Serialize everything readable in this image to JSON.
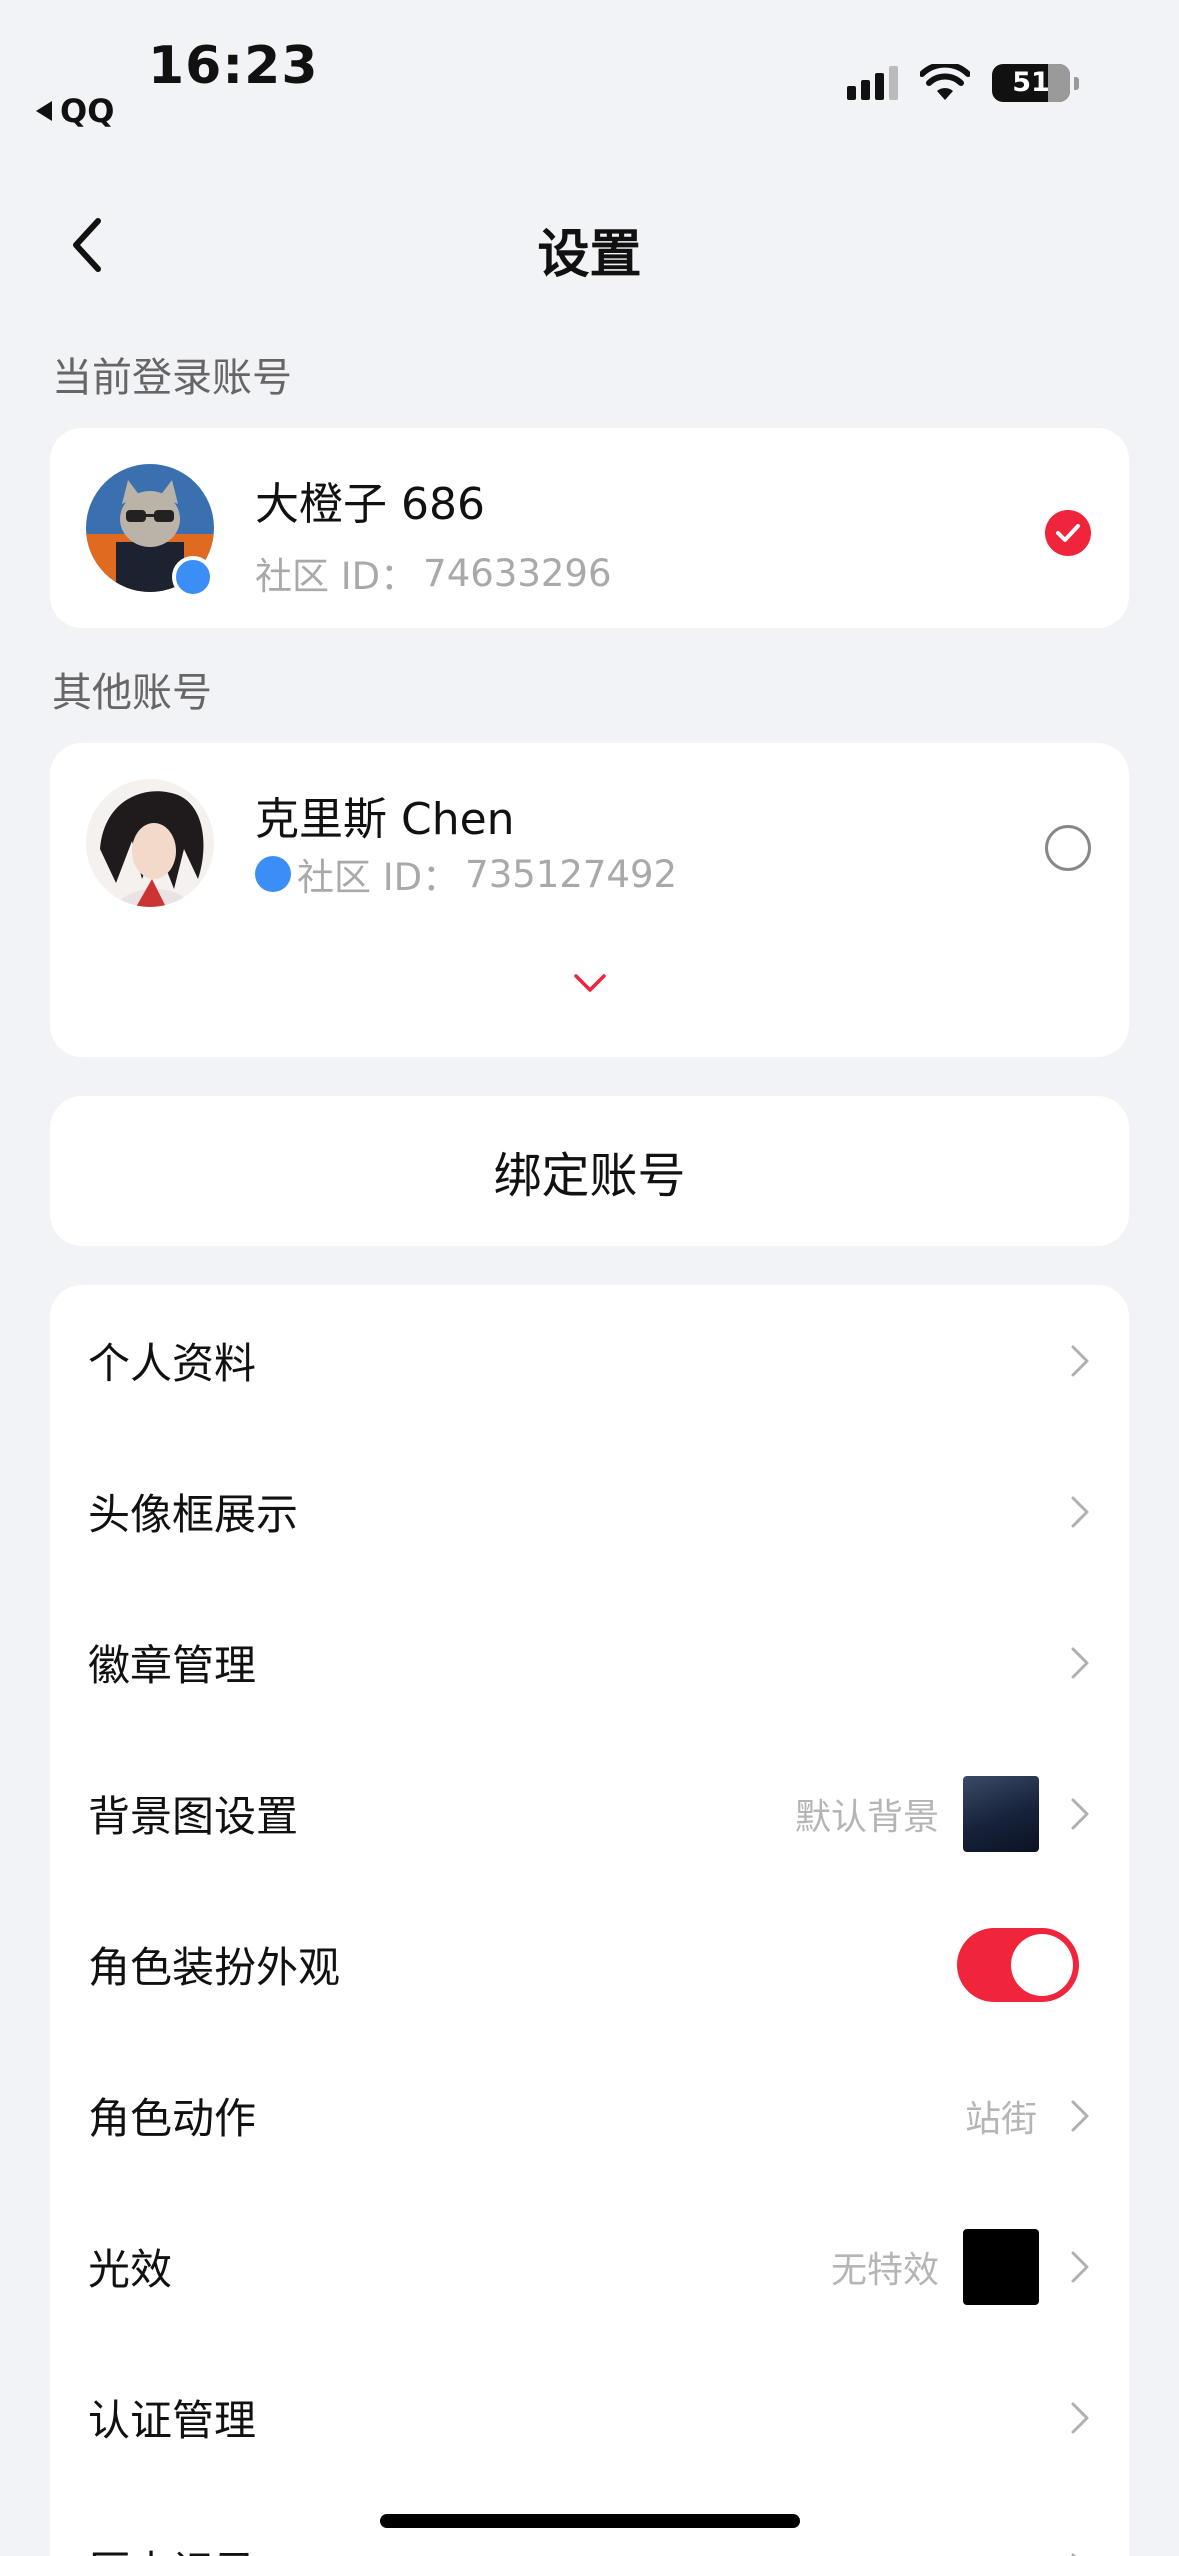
{
  "status_bar": {
    "time": "16:23",
    "back_app": "QQ",
    "battery": "51",
    "icons": [
      "signal-icon",
      "wifi-icon",
      "battery-icon"
    ]
  },
  "nav": {
    "title": "设置",
    "back_icon": "back-chevron-icon"
  },
  "current_account": {
    "section_label": "当前登录账号",
    "name": "大橙子 686",
    "id_label": "社区 ID：",
    "id_value": "74633296",
    "selected": true
  },
  "other_accounts": {
    "section_label": "其他账号",
    "items": [
      {
        "name": "克里斯 Chen",
        "id_label": "社区 ID：",
        "id_value": "735127492",
        "selected": false
      }
    ],
    "expand_icon": "chevron-down-icon"
  },
  "bind_button": {
    "label": "绑定账号"
  },
  "menu": {
    "items": [
      {
        "label": "个人资料"
      },
      {
        "label": "头像框展示"
      },
      {
        "label": "徽章管理"
      },
      {
        "label": "背景图设置",
        "value": "默认背景"
      },
      {
        "label": "角色装扮外观",
        "toggle": true
      },
      {
        "label": "角色动作",
        "value": "站街"
      },
      {
        "label": "光效",
        "value": "无特效"
      },
      {
        "label": "认证管理"
      },
      {
        "label": "历史记录"
      }
    ]
  },
  "colors": {
    "accent": "#f0243a",
    "qq_blue": "#3a8ef6",
    "background": "#f2f3f7",
    "muted_text": "#a9a9a9"
  }
}
